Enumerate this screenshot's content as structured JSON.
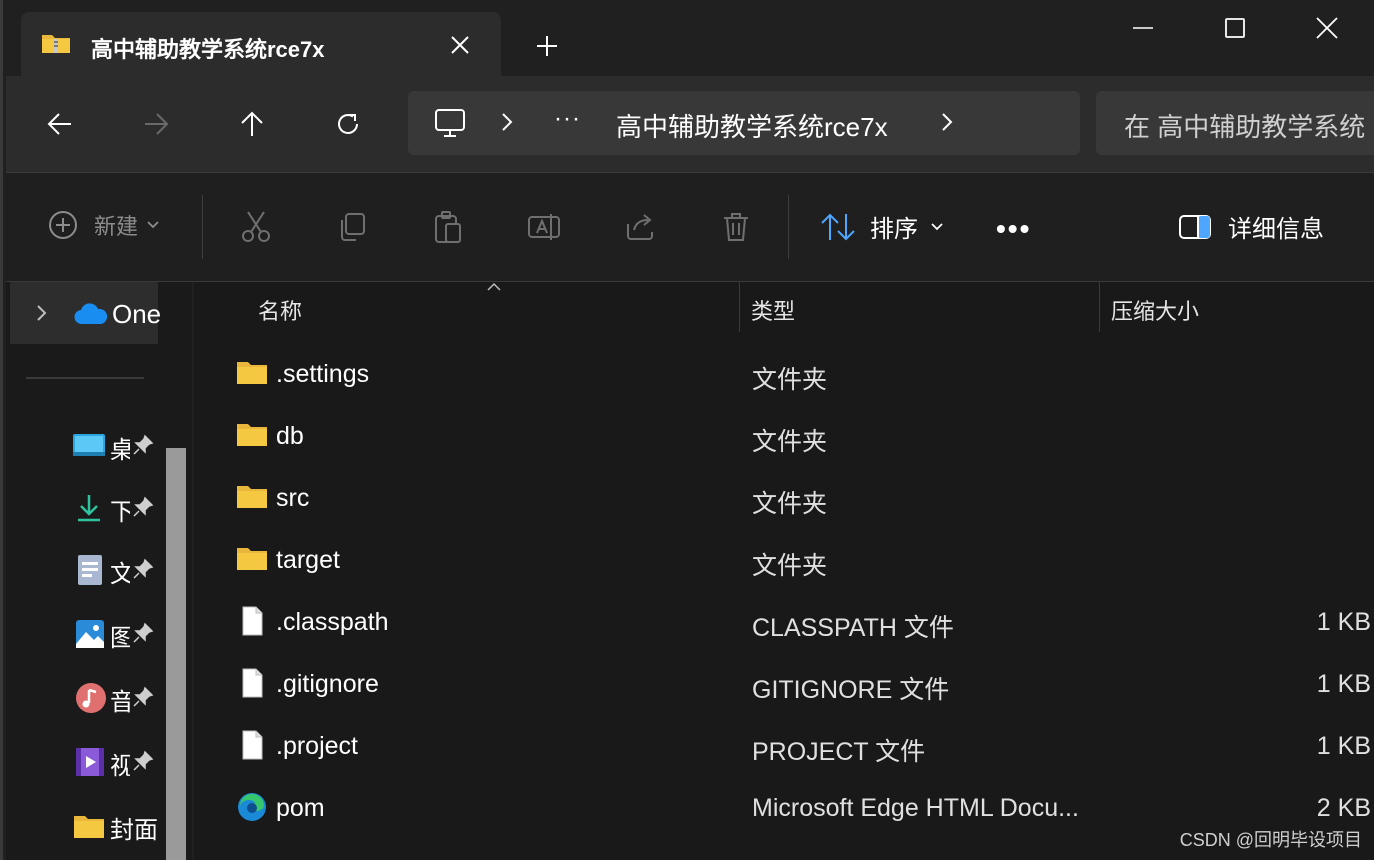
{
  "window": {
    "tab_title": "高中辅助教学系统rce7x"
  },
  "address_bar": {
    "more": "···",
    "path": "高中辅助教学系统rce7x"
  },
  "search": {
    "placeholder": "在 高中辅助教学系统"
  },
  "toolbar": {
    "new_label": "新建",
    "sort_label": "排序",
    "more": "•••",
    "details_label": "详细信息"
  },
  "nav_pane": {
    "onedrive_label": "One",
    "quick_access": [
      {
        "icon": "desktop-icon",
        "label": "桌"
      },
      {
        "icon": "download-icon",
        "label": "下"
      },
      {
        "icon": "documents-icon",
        "label": "文"
      },
      {
        "icon": "pictures-icon",
        "label": "图"
      },
      {
        "icon": "music-icon",
        "label": "音"
      },
      {
        "icon": "videos-icon",
        "label": "视"
      }
    ],
    "last_item": "封面"
  },
  "columns": {
    "name": "名称",
    "type": "类型",
    "size": "压缩大小"
  },
  "files": [
    {
      "name": ".settings",
      "type": "文件夹",
      "size": "",
      "icon": "folder-icon"
    },
    {
      "name": "db",
      "type": "文件夹",
      "size": "",
      "icon": "folder-icon"
    },
    {
      "name": "src",
      "type": "文件夹",
      "size": "",
      "icon": "folder-icon"
    },
    {
      "name": "target",
      "type": "文件夹",
      "size": "",
      "icon": "folder-icon"
    },
    {
      "name": ".classpath",
      "type": "CLASSPATH 文件",
      "size": "1 KB",
      "icon": "file-icon"
    },
    {
      "name": ".gitignore",
      "type": "GITIGNORE 文件",
      "size": "1 KB",
      "icon": "file-icon"
    },
    {
      "name": ".project",
      "type": "PROJECT 文件",
      "size": "1 KB",
      "icon": "file-icon"
    },
    {
      "name": "pom",
      "type": "Microsoft Edge HTML Docu...",
      "size": "2 KB",
      "icon": "edge-icon"
    }
  ],
  "watermark": "CSDN @回明毕设项目",
  "colors": {
    "folder": "#f5c842",
    "accent": "#4ea6ff",
    "background": "#191919"
  }
}
